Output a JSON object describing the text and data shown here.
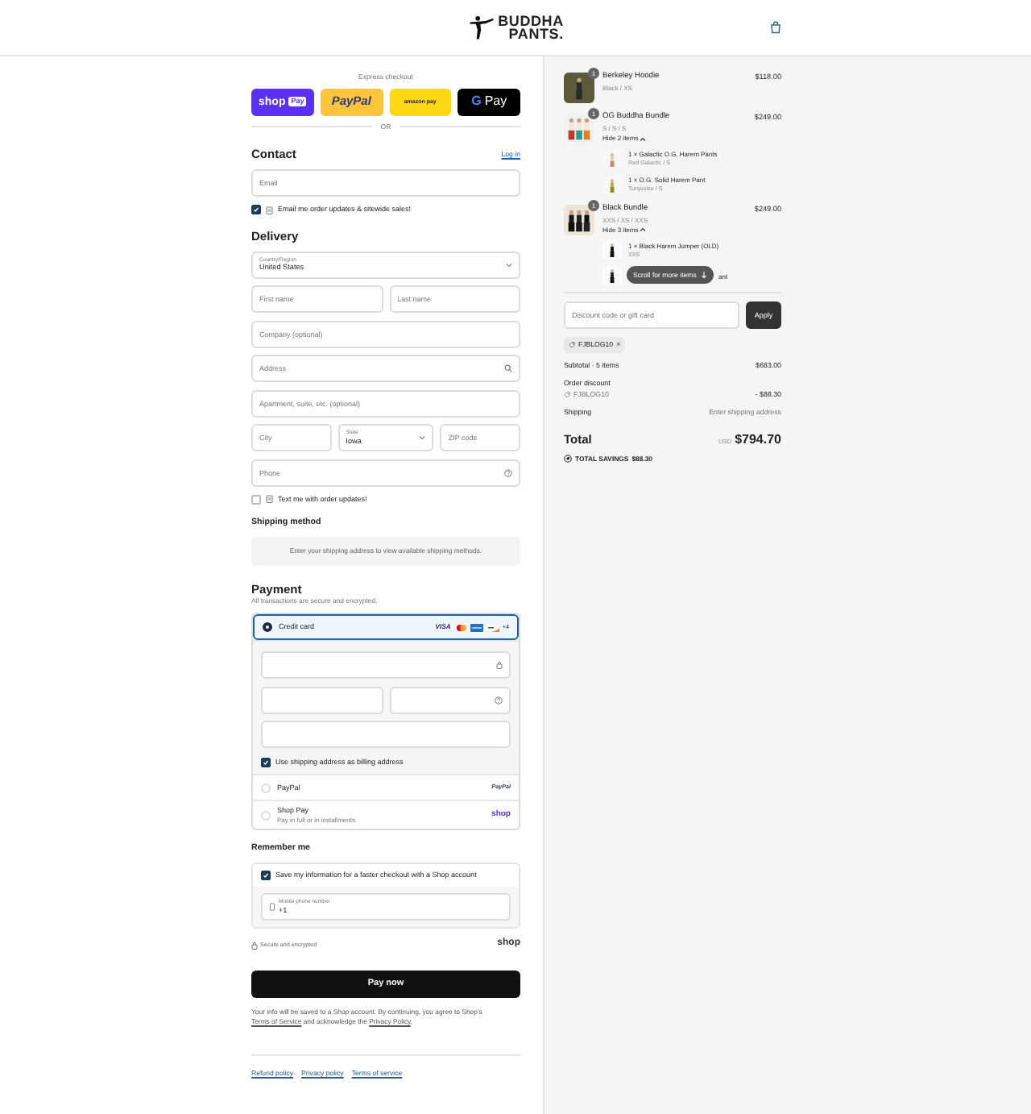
{
  "header": {
    "logo_lines": [
      "BUDDHA",
      "PANTS."
    ]
  },
  "express": {
    "label": "Express checkout",
    "buttons": [
      {
        "kind": "shoppay",
        "label": "shop",
        "badge": "Pay"
      },
      {
        "kind": "paypal",
        "label": "PayPal"
      },
      {
        "kind": "amazonpay",
        "label": "amazon pay"
      },
      {
        "kind": "gpay",
        "mark": "G",
        "label": "Pay"
      }
    ],
    "divider": "OR"
  },
  "contact": {
    "title": "Contact",
    "login": "Log in",
    "email": {
      "kind": "input",
      "placeholder": "Email"
    },
    "news": {
      "label": "Email me order updates & sitewide sales!",
      "checked": true
    }
  },
  "delivery": {
    "title": "Delivery",
    "rows": [
      [
        {
          "kind": "select",
          "label": "Country/Region",
          "value": "United States"
        }
      ],
      [
        {
          "kind": "input",
          "placeholder": "First name"
        },
        {
          "kind": "input",
          "placeholder": "Last name"
        }
      ],
      [
        {
          "kind": "input",
          "placeholder": "Company (optional)"
        }
      ],
      [
        {
          "kind": "search",
          "placeholder": "Address"
        }
      ],
      [
        {
          "kind": "input",
          "placeholder": "Apartment, suite, etc. (optional)"
        }
      ],
      [
        {
          "kind": "input",
          "placeholder": "City"
        },
        {
          "kind": "select",
          "label": "State",
          "value": "Iowa"
        },
        {
          "kind": "input",
          "placeholder": "ZIP code"
        }
      ],
      [
        {
          "kind": "phone",
          "placeholder": "Phone"
        }
      ]
    ],
    "sms": {
      "label": "Text me with order updates!",
      "checked": false
    }
  },
  "shipping": {
    "title": "Shipping method",
    "notice": "Enter your shipping address to view available shipping methods."
  },
  "payment": {
    "title": "Payment",
    "subtitle": "All transactions are secure and encrypted.",
    "methods": [
      {
        "kind": "card",
        "label": "Credit card",
        "selected": true,
        "cards": [
          {
            "kind": "visa",
            "label": "VISA"
          },
          {
            "kind": "mastercard"
          },
          {
            "kind": "amex"
          },
          {
            "kind": "discover"
          }
        ],
        "more": "+4",
        "fields": [
          [
            {
              "kind": "card_number"
            }
          ],
          [
            {
              "kind": "blank"
            },
            {
              "kind": "security_code"
            }
          ],
          [
            {
              "kind": "blank"
            }
          ]
        ],
        "billing": {
          "label": "Use shipping address as billing address",
          "checked": true
        }
      },
      {
        "kind": "paypal",
        "label": "PayPal",
        "logo": "PayPal",
        "selected": false
      },
      {
        "kind": "shoppay",
        "label": "Shop Pay",
        "sub": "Pay in full or in installments",
        "logo": "shop",
        "selected": false
      }
    ]
  },
  "remember": {
    "title": "Remember me",
    "save": {
      "label": "Save my information for a faster checkout with a Shop account",
      "checked": true
    },
    "phone": {
      "label": "Mobile phone number",
      "value": "+1"
    },
    "secure": "Secure and encrypted",
    "logo": "shop"
  },
  "pay_button": "Pay now",
  "legal": [
    {
      "kind": "text",
      "text": "Your info will be saved to a Shop account. By continuing, you agree to Shop’s "
    },
    {
      "kind": "link",
      "text": "Terms of Service"
    },
    {
      "kind": "text",
      "text": " and acknowledge the "
    },
    {
      "kind": "link",
      "text": "Privacy Policy"
    },
    {
      "kind": "text",
      "text": "."
    }
  ],
  "footer_links": [
    "Refund policy",
    "Privacy policy",
    "Terms of service"
  ],
  "summary": {
    "items": [
      {
        "name": "Berkeley Hoodie",
        "variant": "Black / XS",
        "price": "$118.00",
        "quantity": "1"
      },
      {
        "name": "OG Buddha Bundle",
        "variant": "S / S / S",
        "price": "$249.00",
        "quantity": "1",
        "toggle": "Hide 2 items",
        "expanded": true,
        "children": [
          {
            "title": "1 × Galactic O.G. Harem Pants",
            "variant": "Red Galactic / S",
            "covered": false
          },
          {
            "title": "1 × O.G. Solid Harem Pant",
            "variant": "Turquoise / S",
            "covered": false
          }
        ]
      },
      {
        "name": "Black Bundle",
        "variant": "XXS / XS / XXS",
        "price": "$249.00",
        "quantity": "1",
        "toggle": "Hide 3 items",
        "expanded": true,
        "children": [
          {
            "title": "1 × Black Harem Jumper (OLD)",
            "variant": "XXS",
            "covered": false
          },
          {
            "title": "ant",
            "covered": true
          }
        ]
      }
    ],
    "scroll_hint": "Scroll for more items",
    "discount": {
      "placeholder": "Discount code or gift card",
      "apply": "Apply"
    },
    "codes": [
      {
        "code": "FJBLOG10",
        "remove": "×"
      }
    ],
    "subtotal": {
      "label": "Subtotal · 5 items",
      "value": "$683.00"
    },
    "order_discount": {
      "label": "Order discount",
      "code": "FJBLOG10",
      "value": "- $88.30"
    },
    "shipping": {
      "label": "Shipping",
      "value": "Enter shipping address"
    },
    "total": {
      "label": "Total",
      "currency": "USD",
      "value": "$794.70"
    },
    "savings": {
      "label": "TOTAL SAVINGS",
      "value": "$88.30"
    }
  }
}
